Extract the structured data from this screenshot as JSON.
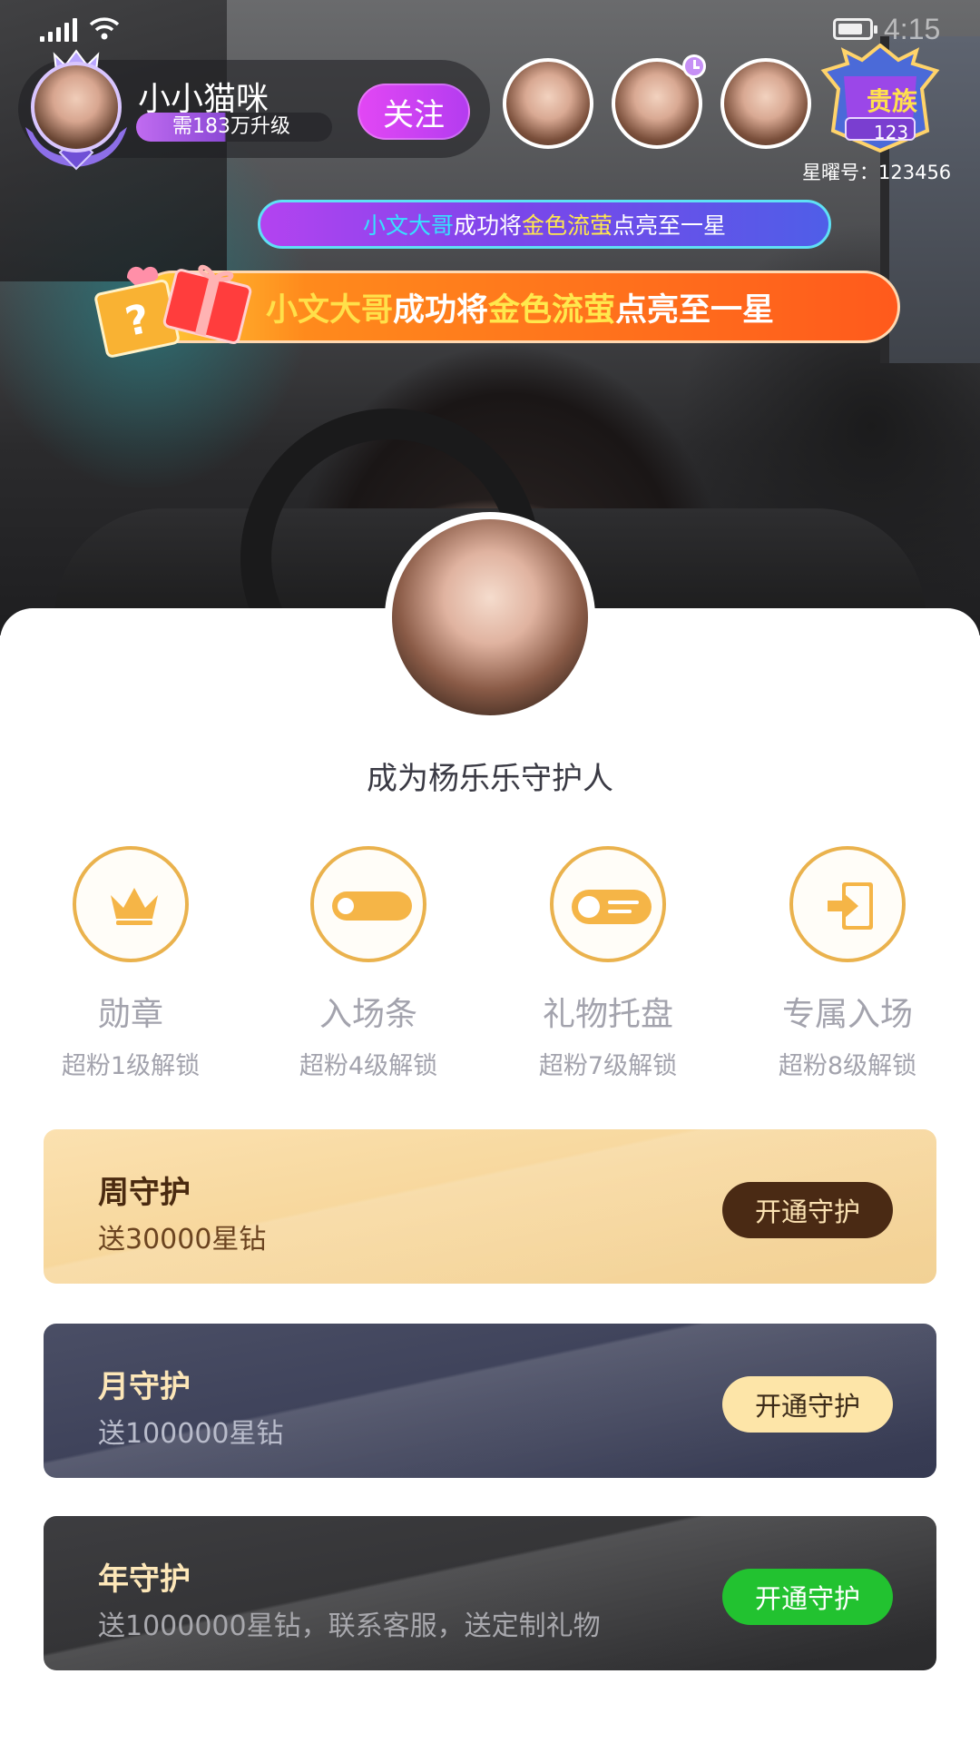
{
  "status_bar": {
    "time": "4:15"
  },
  "host": {
    "name": "小小猫咪",
    "level_text": "需183万升级",
    "follow_label": "关注"
  },
  "noble": {
    "title": "贵族",
    "level": "123",
    "star_id": "星曜号：123456"
  },
  "banner_small": {
    "user": "小文大哥",
    "pre": "成功将",
    "gift": "金色流萤",
    "post": "点亮至一星"
  },
  "banner_big": {
    "user": "小文大哥",
    "pre": "成功将",
    "gift": "金色流萤",
    "post": "点亮至一星"
  },
  "sheet": {
    "title": "成为杨乐乐守护人"
  },
  "perks": [
    {
      "name": "勋章",
      "unlock": "超粉1级解锁",
      "icon": "crown-icon"
    },
    {
      "name": "入场条",
      "unlock": "超粉4级解锁",
      "icon": "toggle-icon"
    },
    {
      "name": "礼物托盘",
      "unlock": "超粉7级解锁",
      "icon": "tray-icon"
    },
    {
      "name": "专属入场",
      "unlock": "超粉8级解锁",
      "icon": "enter-icon"
    }
  ],
  "plans": [
    {
      "name": "周守护",
      "desc": "送30000星钻",
      "button": "开通守护"
    },
    {
      "name": "月守护",
      "desc": "送100000星钻",
      "button": "开通守护"
    },
    {
      "name": "年守护",
      "desc": "送1000000星钻，联系客服，送定制礼物",
      "button": "开通守护"
    }
  ],
  "colors": {
    "accent_purple": "#c94af2",
    "perk_gold": "#eab24d",
    "week_bg": "#f7d79c",
    "month_bg": "#3d4159",
    "year_bg": "#333335",
    "year_button": "#22c230"
  }
}
